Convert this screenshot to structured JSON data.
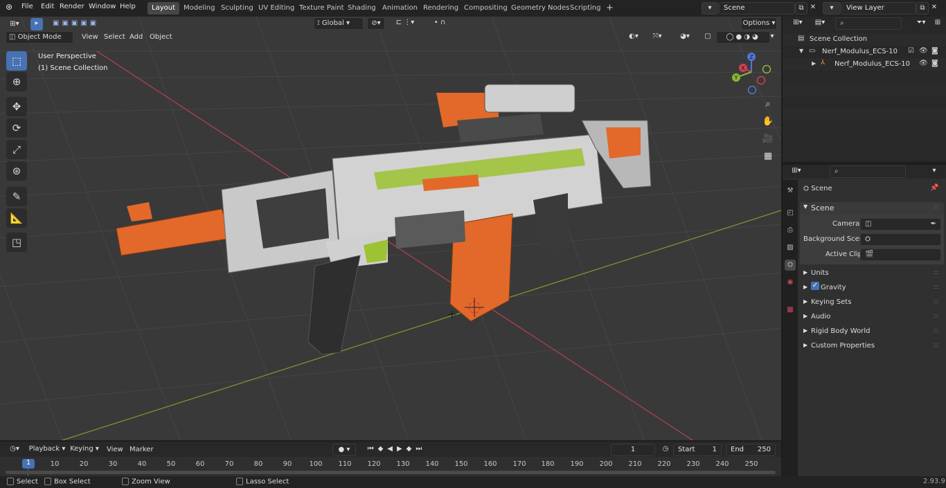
{
  "menu": {
    "file": "File",
    "edit": "Edit",
    "render": "Render",
    "window": "Window",
    "help": "Help"
  },
  "workspaces": [
    "Layout",
    "Modeling",
    "Sculpting",
    "UV Editing",
    "Texture Paint",
    "Shading",
    "Animation",
    "Rendering",
    "Compositing",
    "Geometry Nodes",
    "Scripting"
  ],
  "scene_field": "Scene",
  "view_layer_field": "View Layer",
  "header": {
    "transform_orientation": "Global",
    "options": "Options"
  },
  "viewport": {
    "mode": "Object Mode",
    "view": "View",
    "select": "Select",
    "add": "Add",
    "object": "Object",
    "perspective_label": "User Perspective",
    "collection_label": "(1) Scene Collection"
  },
  "gizmo": {
    "x": "X",
    "y": "Y",
    "z": "Z"
  },
  "outliner": {
    "root": "Scene Collection",
    "collection": "Nerf_Modulus_ECS-10",
    "object": "Nerf_Modulus_ECS-10"
  },
  "properties": {
    "context": "Scene",
    "panel": "Scene",
    "camera_label": "Camera",
    "background_label": "Background Scene",
    "clip_label": "Active Clip",
    "sections": [
      "Units",
      "Gravity",
      "Keying Sets",
      "Audio",
      "Rigid Body World",
      "Custom Properties"
    ]
  },
  "timeline": {
    "playback": "Playback",
    "keying": "Keying",
    "view": "View",
    "marker": "Marker",
    "current_frame": "1",
    "start_label": "Start",
    "start": "1",
    "end_label": "End",
    "end": "250",
    "ticks": [
      "10",
      "20",
      "30",
      "40",
      "50",
      "60",
      "70",
      "80",
      "90",
      "100",
      "110",
      "120",
      "130",
      "140",
      "150",
      "160",
      "170",
      "180",
      "190",
      "200",
      "210",
      "220",
      "230",
      "240",
      "250"
    ],
    "playhead": "1"
  },
  "status": {
    "select": "Select",
    "box_select": "Box Select",
    "zoom_view": "Zoom View",
    "lasso_select": "Lasso Select",
    "version": "2.93.9"
  },
  "colors": {
    "accent": "#4772b3",
    "x_axis": "#b5424e",
    "y_axis": "#7a9e2f",
    "model_orange": "#e2692a"
  }
}
